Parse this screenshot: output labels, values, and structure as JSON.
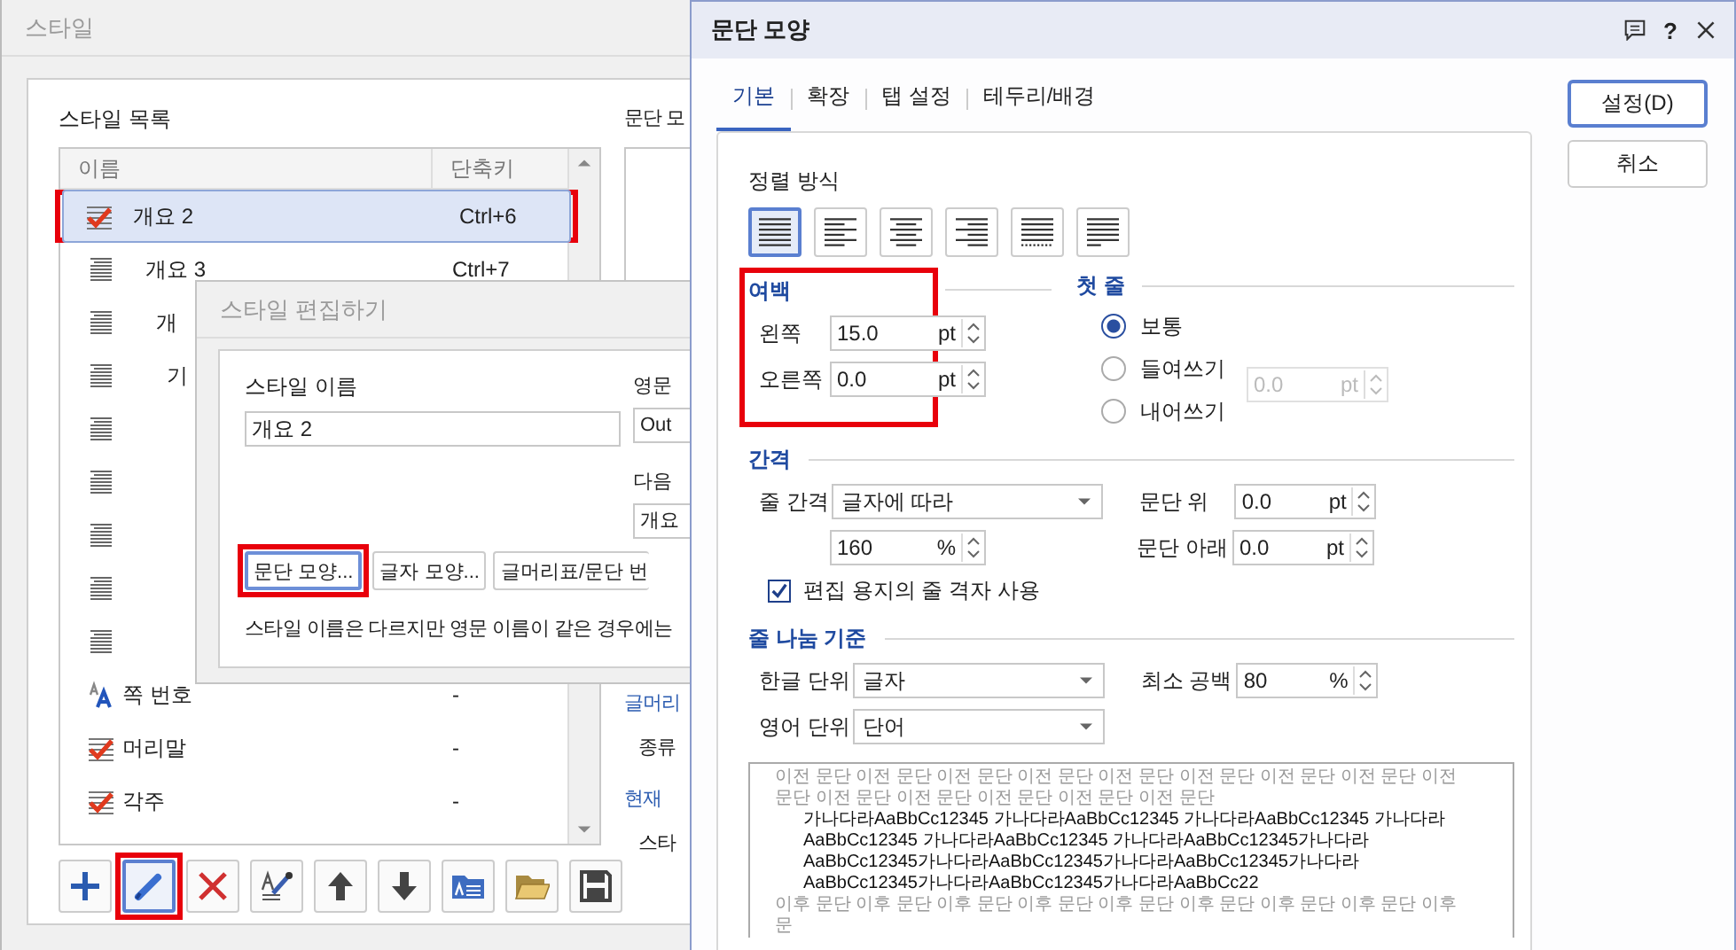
{
  "style_window": {
    "title": "스타일",
    "list_label": "스타일 목록",
    "columns": [
      "이름",
      "단축키"
    ],
    "styles": [
      {
        "name": "개요 2",
        "shortcut": "Ctrl+6",
        "kind": "marked",
        "selected": true,
        "highlighted": true,
        "children": [
          {
            "name": "개요 3",
            "shortcut": "Ctrl+7",
            "kind": "paragraph",
            "selected": false,
            "highlighted": false,
            "children": [
              {
                "name": "개",
                "kind": "paragraph",
                "selected": false,
                "highlighted": false,
                "children": [
                  {
                    "name": "기",
                    "kind": "paragraph",
                    "selected": false,
                    "highlighted": false
                  }
                ]
              }
            ]
          }
        ]
      },
      {
        "kind": "paragraph",
        "selected": false,
        "highlighted": false
      },
      {
        "kind": "paragraph",
        "selected": false,
        "highlighted": false
      },
      {
        "kind": "paragraph",
        "selected": false,
        "highlighted": false
      },
      {
        "kind": "paragraph",
        "selected": false,
        "highlighted": false
      },
      {
        "kind": "paragraph",
        "selected": false,
        "highlighted": false
      },
      {
        "name": "쪽 번호",
        "shortcut": "-",
        "kind": "character",
        "selected": false,
        "highlighted": false
      },
      {
        "name": "머리말",
        "shortcut": "-",
        "kind": "marked",
        "selected": false,
        "highlighted": false
      },
      {
        "name": "각주",
        "shortcut": "-",
        "kind": "marked",
        "selected": false,
        "highlighted": false
      }
    ],
    "toolbar": [
      {
        "kind": "add",
        "selected": false,
        "highlighted": false
      },
      {
        "kind": "edit",
        "selected": true,
        "highlighted": true
      },
      {
        "kind": "delete",
        "selected": false,
        "highlighted": false
      },
      {
        "kind": "eyedropper",
        "selected": false,
        "highlighted": false
      },
      {
        "kind": "up",
        "selected": false,
        "highlighted": false
      },
      {
        "kind": "down",
        "selected": false,
        "highlighted": false
      },
      {
        "kind": "import",
        "selected": false,
        "highlighted": false
      },
      {
        "kind": "open",
        "selected": false,
        "highlighted": false
      },
      {
        "kind": "save",
        "selected": false,
        "highlighted": false
      }
    ],
    "side": [
      {
        "text": "문단 모",
        "kind": "label"
      },
      {
        "kind": "preview"
      },
      {
        "text": "글머리",
        "kind": "heading"
      },
      {
        "text": "종류",
        "kind": "item"
      },
      {
        "text": "현재",
        "kind": "heading"
      },
      {
        "text": "스타",
        "kind": "item"
      }
    ]
  },
  "edit_window": {
    "title": "스타일 편집하기",
    "name_label": "스타일 이름",
    "name_value": "개요 2",
    "english_label": "영문",
    "english_value": "Out",
    "next_label": "다음",
    "next_value": "개요",
    "buttons": [
      {
        "label": "문단 모양...",
        "focused": true,
        "highlighted": true
      },
      {
        "label": "글자 모양...",
        "focused": false,
        "highlighted": false
      },
      {
        "label": "글머리표/문단 번",
        "focused": false,
        "highlighted": false
      }
    ],
    "note": "스타일 이름은 다르지만 영문 이름이 같은 경우에는"
  },
  "paragraph_window": {
    "title": "문단 모양",
    "help": "?",
    "tabs": [
      {
        "label": "기본",
        "selected": true
      },
      {
        "label": "확장",
        "selected": false
      },
      {
        "label": "탭 설정",
        "selected": false
      },
      {
        "label": "테두리/배경",
        "selected": false
      }
    ],
    "buttons": [
      {
        "label": "설정(D)",
        "default": true
      },
      {
        "label": "취소",
        "default": false
      }
    ],
    "alignment": {
      "label": "정렬 방식",
      "options": [
        {
          "kind": "justify",
          "selected": true
        },
        {
          "kind": "left",
          "selected": false
        },
        {
          "kind": "center",
          "selected": false
        },
        {
          "kind": "right",
          "selected": false
        },
        {
          "kind": "distribute",
          "selected": false
        },
        {
          "kind": "divide",
          "selected": false
        }
      ]
    },
    "margin": {
      "title": "여백",
      "highlighted": true,
      "fields": [
        {
          "label": "왼쪽",
          "value": "15.0",
          "unit": "pt"
        },
        {
          "label": "오른쪽",
          "value": "0.0",
          "unit": "pt"
        }
      ]
    },
    "first_line": {
      "title": "첫 줄",
      "options": [
        {
          "label": "보통",
          "selected": true
        },
        {
          "label": "들여쓰기",
          "selected": false
        },
        {
          "label": "내어쓰기",
          "selected": false
        }
      ],
      "value": "0.0",
      "unit": "pt",
      "disabled": true
    },
    "spacing": {
      "title": "간격",
      "line_label": "줄 간격",
      "line_mode": "글자에 따라",
      "line_value": "160",
      "line_unit": "%",
      "above_label": "문단 위",
      "above_value": "0.0",
      "above_unit": "pt",
      "below_label": "문단 아래",
      "below_value": "0.0",
      "below_unit": "pt",
      "grid_label": "편집 용지의 줄 격자 사용",
      "grid_checked": true
    },
    "line_break": {
      "title": "줄 나눔 기준",
      "korean_label": "한글 단위",
      "korean_value": "글자",
      "english_label": "영어 단위",
      "english_value": "단어",
      "min_label": "최소 공백",
      "min_value": "80",
      "min_unit": "%"
    },
    "preview": [
      {
        "kind": "before",
        "text": "이전 문단 이전 문단 이전 문단 이전 문단 이전 문단 이전 문단 이전 문단 이전 문단 이전 문단 이전 문단 이전 문단 이전 문단 이전 문단 이전 문단"
      },
      {
        "kind": "current",
        "text": "가나다라AaBbCc12345 가나다라AaBbCc12345 가나다라AaBbCc12345 가나다라AaBbCc12345 가나다라AaBbCc12345 가나다라AaBbCc12345가나다라AaBbCc12345가나다라AaBbCc12345가나다라AaBbCc12345가나다라AaBbCc12345가나다라AaBbCc12345가나다라AaBbCc22"
      },
      {
        "kind": "after",
        "text": "이후 문단 이후 문단 이후 문단 이후 문단 이후 문단 이후 문단 이후 문단 이후 문단 이후 문"
      }
    ]
  }
}
